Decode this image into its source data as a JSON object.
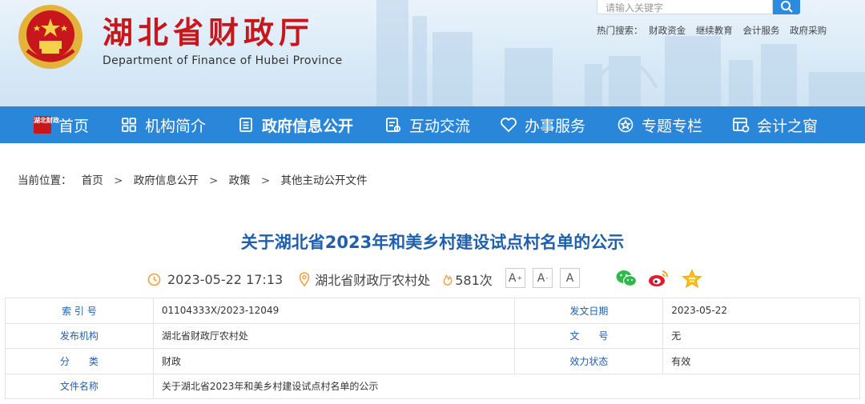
{
  "header": {
    "title": "湖北省财政厅",
    "subtitle": "Department of Finance of Hubei Province",
    "search_placeholder": "请输入关键字",
    "hot_label": "热门搜索：",
    "hot_terms": [
      "财政资金",
      "继续教育",
      "会计服务",
      "政府采购"
    ]
  },
  "nav": {
    "home_badge": "湖北财政",
    "items": [
      {
        "label": "首页",
        "icon": "home-badge-icon"
      },
      {
        "label": "机构简介",
        "icon": "grid-icon"
      },
      {
        "label": "政府信息公开",
        "icon": "document-icon"
      },
      {
        "label": "互动交流",
        "icon": "chat-doc-icon"
      },
      {
        "label": "办事服务",
        "icon": "heart-icon"
      },
      {
        "label": "专题专栏",
        "icon": "star-circle-icon"
      },
      {
        "label": "会计之窗",
        "icon": "window-icon"
      }
    ]
  },
  "breadcrumb": {
    "label": "当前位置：",
    "items": [
      "首页",
      "政府信息公开",
      "政策",
      "其他主动公开文件"
    ],
    "separator": ">"
  },
  "article": {
    "title": "关于湖北省2023年和美乡村建设试点村名单的公示",
    "datetime": "2023-05-22 17:13",
    "department": "湖北省财政厅农村处",
    "views": "581次",
    "font_buttons": [
      "A",
      "A",
      "A"
    ]
  },
  "info": {
    "rows": [
      {
        "k1": "索 引 号",
        "v1": "01104333X/2023-12049",
        "k2": "发文日期",
        "v2": "2023-05-22"
      },
      {
        "k1": "发布机构",
        "v1": "湖北省财政厅农村处",
        "k2": "文　　号",
        "v2": "无"
      },
      {
        "k1": "分　　类",
        "v1": "财政",
        "k2": "效力状态",
        "v2": "有效"
      },
      {
        "k1": "文件名称",
        "v1": "关于湖北省2023年和美乡村建设试点村名单的公示"
      }
    ]
  },
  "colors": {
    "brand_red": "#c8161d",
    "nav_blue": "#2a86d9",
    "title_blue": "#1f5fae"
  }
}
